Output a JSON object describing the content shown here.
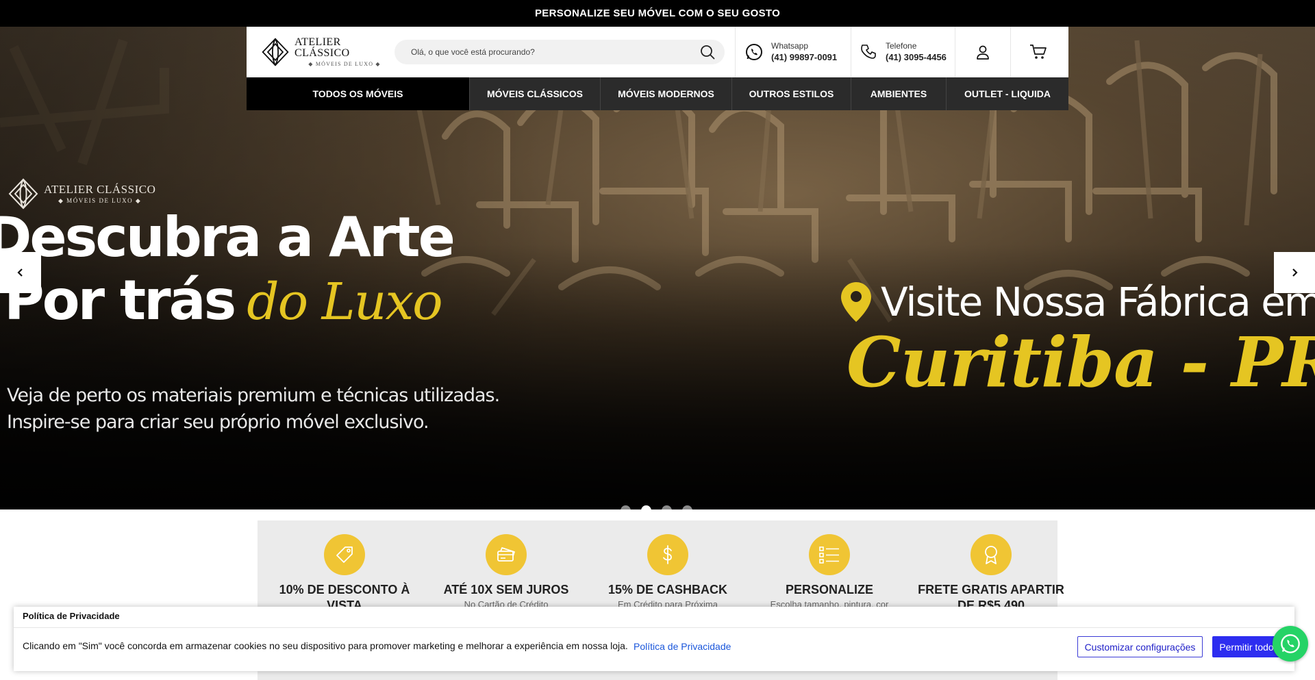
{
  "announcement": {
    "text": "PERSONALIZE SEU MÓVEL COM O SEU GOSTO"
  },
  "header": {
    "logo": {
      "name": "ATELIER CLÁSSICO",
      "sub": "◆ MÓVEIS DE LUXO ◆"
    },
    "search": {
      "placeholder": "Olá, o que você está procurando?",
      "value": ""
    },
    "whatsapp": {
      "label": "Whatsapp",
      "number": "(41) 99897-0091"
    },
    "phone": {
      "label": "Telefone",
      "number": "(41) 3095-4456"
    }
  },
  "nav": {
    "all": "TODOS OS MÓVEIS",
    "items": [
      {
        "label": "MÓVEIS CLÁSSICOS",
        "width": 191
      },
      {
        "label": "MÓVEIS MODERNOS",
        "width": 192
      },
      {
        "label": "OUTROS ESTILOS",
        "width": 174
      },
      {
        "label": "AMBIENTES",
        "width": 139
      },
      {
        "label": "OUTLET - LIQUIDA",
        "width": 178
      }
    ]
  },
  "hero": {
    "logo": {
      "name": "ATELIER CLÁSSICO",
      "sub": "◆ MÓVEIS DE LUXO ◆"
    },
    "headline_line1": "Descubra a Arte",
    "headline_line2_white": "Por trás",
    "headline_line2_yellow": "do Luxo",
    "paragraph_line1": "Veja de perto os materiais premium e técnicas utilizadas.",
    "paragraph_line2": "Inspire-se para criar seu próprio móvel exclusivo.",
    "right_line1": "Visite Nossa Fábrica em",
    "right_line2": "Curitiba - PR",
    "slides_total": 4,
    "active_slide": 2
  },
  "features": [
    {
      "title": "10% DE DESCONTO À VISTA",
      "desc": "",
      "icon": "tag-icon"
    },
    {
      "title": "ATÉ 10X SEM JUROS",
      "desc": "No Cartão de Crédito",
      "icon": "credit-card-icon"
    },
    {
      "title": "15% DE CASHBACK",
      "desc": "Em Crédito para Próxima",
      "icon": "dollar-icon"
    },
    {
      "title": "PERSONALIZE",
      "desc": "Escolha tamanho, pintura, cor",
      "icon": "list-icon"
    },
    {
      "title": "FRETE GRATIS APARTIR DE R$5.490",
      "desc": "",
      "icon": "award-icon"
    }
  ],
  "cookie": {
    "title": "Política de Privacidade",
    "text": "Clicando em \"Sim\" você concorda em armazenar cookies no seu dispositivo para promover marketing e melhorar a experiência em nossa loja.",
    "link": "Política de Privacidade",
    "customize": "Customizar configurações",
    "allow": "Permitir todos"
  },
  "colors": {
    "accent_yellow": "#f0c534",
    "headline_yellow": "#e5c522",
    "primary_blue": "#2d2df0",
    "whatsapp_green": "#25d366"
  }
}
